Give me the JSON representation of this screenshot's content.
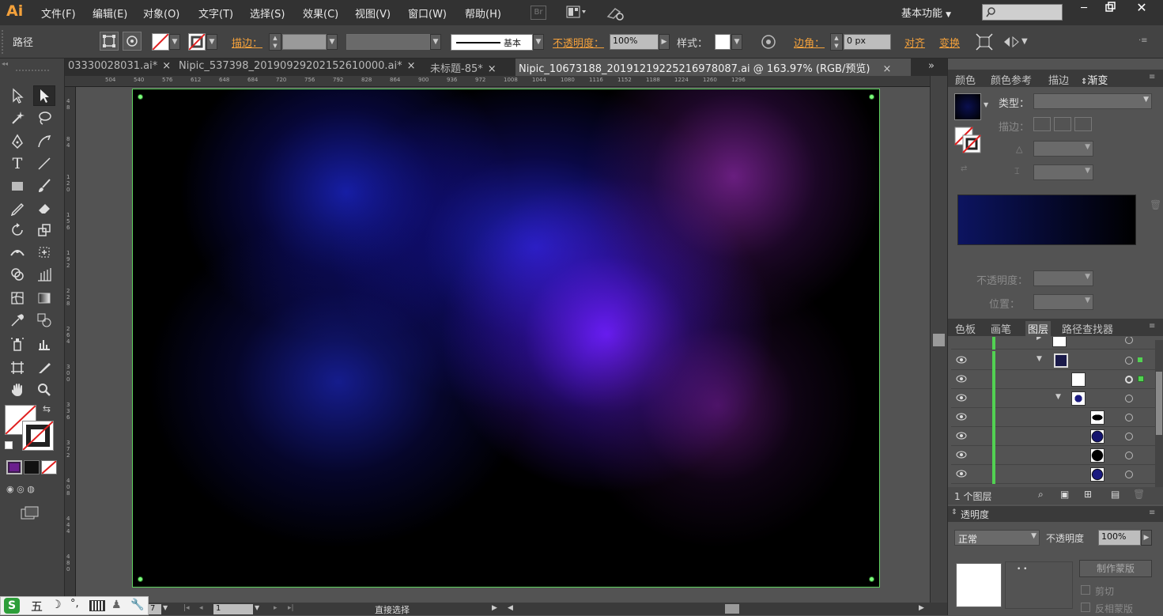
{
  "app": {
    "logo": "Ai"
  },
  "menus": [
    "文件(F)",
    "编辑(E)",
    "对象(O)",
    "文字(T)",
    "选择(S)",
    "效果(C)",
    "视图(V)",
    "窗口(W)",
    "帮助(H)"
  ],
  "menubar_right": {
    "br_label": "Br",
    "workspace": "基本功能"
  },
  "control": {
    "selection_label": "路径",
    "stroke_label": "描边：",
    "stroke_style_label": "基本",
    "opacity_label": "不透明度：",
    "opacity_value": "100%",
    "style_label": "样式：",
    "corner_label": "边角：",
    "corner_value": "0 px",
    "align_label": "对齐",
    "transform_label": "变换"
  },
  "tabs": [
    {
      "label": "03330028031.ai*",
      "active": false
    },
    {
      "label": "Nipic_537398_20190929202152610000.ai*",
      "active": false
    },
    {
      "label": "未标题-85*",
      "active": false
    },
    {
      "label": "Nipic_10673188_20191219225216978087.ai @ 163.97% (RGB/预览)",
      "active": true
    }
  ],
  "tab_close": "×",
  "ruler_top_ticks": [
    "504",
    "540",
    "576",
    "612",
    "648",
    "684",
    "720",
    "756",
    "792",
    "828",
    "864",
    "900",
    "936",
    "972",
    "1008",
    "1044",
    "1080",
    "1116",
    "1152",
    "1188",
    "1224",
    "1260",
    "1296"
  ],
  "ruler_left_ticks": [
    "48",
    "84",
    "120",
    "156",
    "192",
    "228",
    "264",
    "300",
    "336",
    "372",
    "408",
    "444",
    "480"
  ],
  "gradient_panel": {
    "tabs": [
      "颜色",
      "颜色参考",
      "描边",
      "渐变"
    ],
    "active_tab": "渐变",
    "type_label": "类型：",
    "stroke_label": "描边：",
    "opacity_label": "不透明度：",
    "position_label": "位置："
  },
  "layers_panel": {
    "tabs": [
      "色板",
      "画笔",
      "图层",
      "路径查找器"
    ],
    "active_tab": "图层",
    "footer_count": "1 个图层"
  },
  "transparency_panel": {
    "title": "透明度",
    "blend_mode": "正常",
    "opacity_label": "不透明度",
    "opacity_value": "100%",
    "make_mask_button": "制作蒙版",
    "clip_label": "剪切",
    "invert_label": "反相蒙版"
  },
  "status": {
    "zoom": "7",
    "page": "1",
    "tool_name": "直接选择"
  },
  "taskbar": {
    "ime_logo": "S",
    "ime_mode": "五"
  },
  "colors": {
    "accent_orange": "#f4a13b",
    "selection_green": "#52d152",
    "panel_bg": "#535353",
    "menubar_bg": "#323232"
  }
}
